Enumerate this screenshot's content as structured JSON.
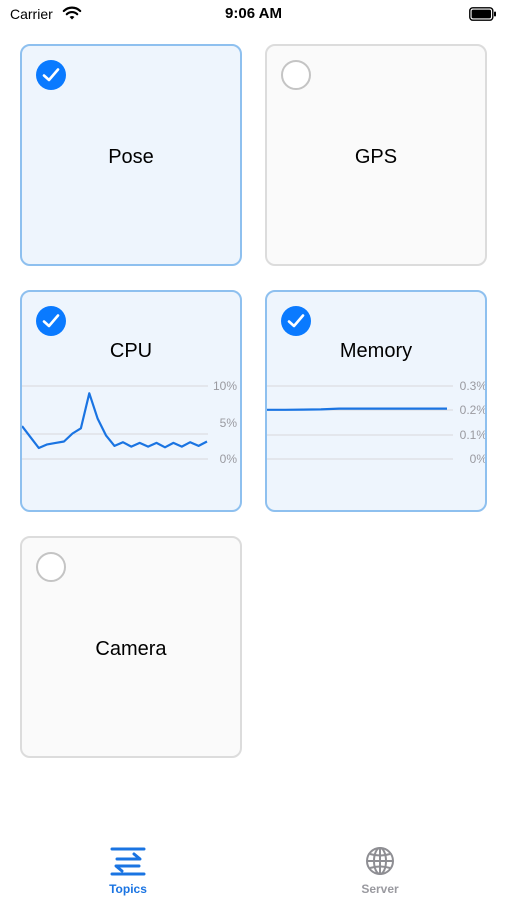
{
  "status_bar": {
    "carrier": "Carrier",
    "time": "9:06 AM"
  },
  "topics": [
    {
      "title": "Pose",
      "selected": true
    },
    {
      "title": "GPS",
      "selected": false
    },
    {
      "title": "CPU",
      "selected": true
    },
    {
      "title": "Memory",
      "selected": true
    },
    {
      "title": "Camera",
      "selected": false
    }
  ],
  "cpu_chart": {
    "tick_labels": [
      "10%",
      "5%",
      "0%"
    ],
    "ylim": [
      0,
      10
    ],
    "values": [
      4.5,
      3.0,
      1.5,
      2.0,
      2.2,
      2.4,
      3.5,
      4.2,
      9.0,
      5.5,
      3.2,
      1.8,
      2.3,
      1.7,
      2.2,
      1.7,
      2.2,
      1.6,
      2.2,
      1.7,
      2.3,
      1.8,
      2.4
    ]
  },
  "memory_chart": {
    "tick_labels": [
      "0.3%",
      "0.2%",
      "0.1%",
      "0%"
    ],
    "ylim": [
      0,
      0.3
    ],
    "values": [
      0.202,
      0.202,
      0.203,
      0.204,
      0.207,
      0.207,
      0.207,
      0.207,
      0.207,
      0.207,
      0.207
    ]
  },
  "tab_bar": {
    "tabs": [
      {
        "label": "Topics",
        "icon": "arrows-swap-icon",
        "active": true
      },
      {
        "label": "Server",
        "icon": "globe-icon",
        "active": false
      }
    ]
  },
  "colors": {
    "accent": "#1a74e2",
    "selected_border": "#8ec0ef",
    "selected_bg": "#eef5fd"
  }
}
